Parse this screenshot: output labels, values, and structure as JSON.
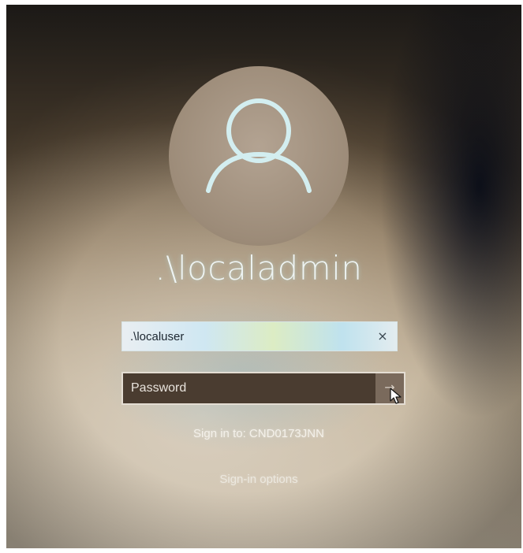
{
  "lock_screen": {
    "avatar_icon": "user-silhouette-icon",
    "username": ".\\localadmin",
    "username_field": {
      "value": ".\\localuser",
      "clear_icon": "close-icon",
      "clear_glyph": "×"
    },
    "password_field": {
      "placeholder": "Password",
      "submit_icon": "arrow-right-icon",
      "submit_glyph": "→"
    },
    "sign_in_to": "Sign in to: CND0173JNN",
    "sign_in_options": "Sign-in options"
  },
  "colors": {
    "text_light": "#eef4f3",
    "password_box_bg": "#4a3c30",
    "username_field_tint": "#cfe7f2"
  }
}
